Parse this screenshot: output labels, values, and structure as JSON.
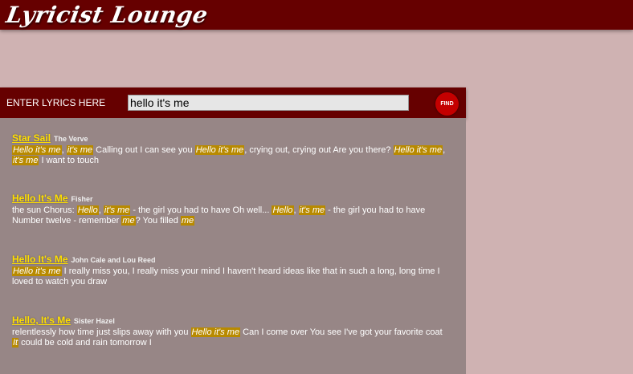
{
  "app": {
    "title": "Lyricist Lounge"
  },
  "search": {
    "label": "ENTER LYRICS HERE",
    "query": "hello it's me",
    "button_label": "FIND"
  },
  "results": [
    {
      "title": "Star Sail",
      "artist": "The Verve",
      "snippet": [
        {
          "t": "Hello it's me",
          "h": true
        },
        {
          "t": ", ",
          "h": false
        },
        {
          "t": "it's me",
          "h": true
        },
        {
          "t": " Calling out I can see you ",
          "h": false
        },
        {
          "t": "Hello it's me",
          "h": true
        },
        {
          "t": ", crying out, crying out Are you there? ",
          "h": false
        },
        {
          "t": "Hello it's me",
          "h": true
        },
        {
          "t": ", ",
          "h": false
        },
        {
          "t": "it's me",
          "h": true
        },
        {
          "t": " I want to touch",
          "h": false
        }
      ]
    },
    {
      "title": "Hello It's Me",
      "artist": "Fisher",
      "snippet": [
        {
          "t": "the sun Chorus: ",
          "h": false
        },
        {
          "t": "Hello",
          "h": true
        },
        {
          "t": ", ",
          "h": false
        },
        {
          "t": "it's me",
          "h": true
        },
        {
          "t": " - the girl you had to have Oh well... ",
          "h": false
        },
        {
          "t": "Hello",
          "h": true
        },
        {
          "t": ", ",
          "h": false
        },
        {
          "t": "it's me",
          "h": true
        },
        {
          "t": " - the girl you had to have Number twelve - remember ",
          "h": false
        },
        {
          "t": "me",
          "h": true
        },
        {
          "t": "? You filled ",
          "h": false
        },
        {
          "t": "me",
          "h": true
        }
      ]
    },
    {
      "title": "Hello It's Me",
      "artist": "John Cale and Lou Reed",
      "snippet": [
        {
          "t": "Hello it's me",
          "h": true
        },
        {
          "t": " I really miss you, I really miss your mind I haven't heard ideas like that in such a long, long time I loved to watch you draw",
          "h": false
        }
      ]
    },
    {
      "title": "Hello, It's Me",
      "artist": "Sister Hazel",
      "snippet": [
        {
          "t": "relentlessly how time just slips away with you ",
          "h": false
        },
        {
          "t": "Hello it's me",
          "h": true
        },
        {
          "t": " Can I come over You see I've got your favorite coat ",
          "h": false
        },
        {
          "t": "It",
          "h": true
        },
        {
          "t": " could be cold and rain tomorrow I",
          "h": false
        }
      ]
    }
  ]
}
